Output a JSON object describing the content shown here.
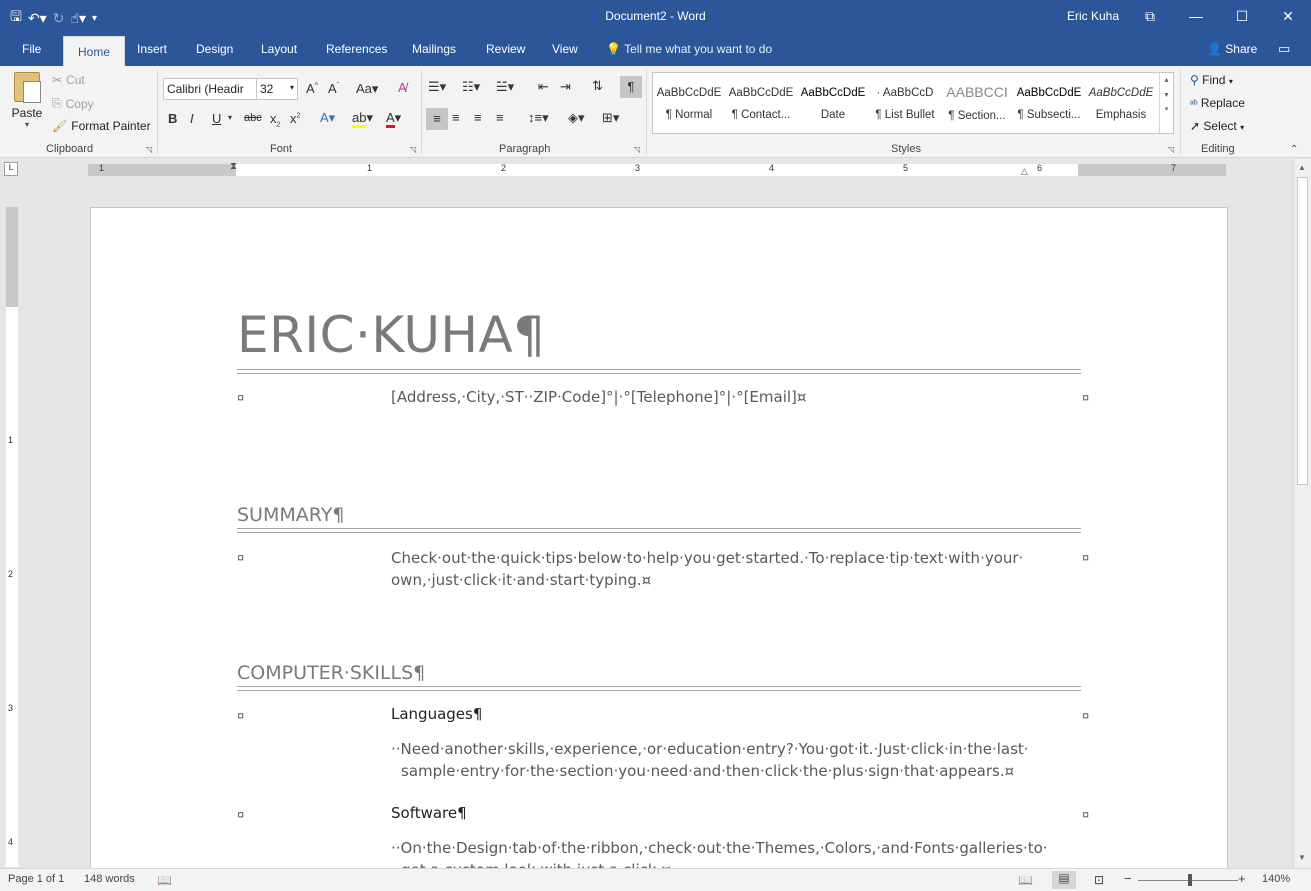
{
  "titlebar": {
    "document_title": "Document2 - Word",
    "user": "Eric Kuha"
  },
  "tabs": [
    "File",
    "Home",
    "Insert",
    "Design",
    "Layout",
    "References",
    "Mailings",
    "Review",
    "View"
  ],
  "tell_me": "Tell me what you want to do",
  "share": "Share",
  "clipboard": {
    "paste": "Paste",
    "cut": "Cut",
    "copy": "Copy",
    "format_painter": "Format Painter",
    "label": "Clipboard"
  },
  "font": {
    "name": "Calibri (Headir",
    "size": "32",
    "label": "Font"
  },
  "paragraph": {
    "label": "Paragraph"
  },
  "styles": {
    "label": "Styles",
    "items": [
      {
        "sample": "AaBbCcDdE",
        "name": "¶ Normal"
      },
      {
        "sample": "AaBbCcDdE",
        "name": "¶ Contact..."
      },
      {
        "sample": "AaBbCcDdE",
        "name": "Date"
      },
      {
        "sample": "· AaBbCcD",
        "name": "¶ List Bullet"
      },
      {
        "sample": "AABBCCI",
        "name": "¶ Section..."
      },
      {
        "sample": "AaBbCcDdE",
        "name": "¶ Subsecti..."
      },
      {
        "sample": "AaBbCcDdE",
        "name": "Emphasis"
      }
    ]
  },
  "editing": {
    "find": "Find",
    "replace": "Replace",
    "select": "Select",
    "label": "Editing"
  },
  "ruler_numbers": [
    "1",
    "1",
    "2",
    "3",
    "4",
    "5",
    "6",
    "7"
  ],
  "vruler_numbers": [
    "1",
    "2",
    "3",
    "4"
  ],
  "document": {
    "name": "ERIC·KUHA¶",
    "contact": "[Address,·City,·ST··ZIP·Code]°|·°[Telephone]°|·°[Email]¤",
    "summary_title": "SUMMARY¶",
    "summary_text": "Check·out·the·quick·tips·below·to·help·you·get·started.·To·replace·tip·text·with·your· own,·just·click·it·and·start·typing.¤",
    "skills_title": "COMPUTER·SKILLS¶",
    "languages_title": "Languages¶",
    "languages_text": "··Need·another·skills,·experience,·or·education·entry?·You·got·it.·Just·click·in·the·last· sample·entry·for·the·section·you·need·and·then·click·the·plus·sign·that·appears.¤",
    "software_title": "Software¶",
    "software_text": "··On·the·Design·tab·of·the·ribbon,·check·out·the·Themes,·Colors,·and·Fonts·galleries·to· get·a·custom·look·with·just·a·click.¤",
    "cell_mark": "¤"
  },
  "status": {
    "page": "Page 1 of 1",
    "words": "148 words",
    "zoom": "140%"
  }
}
